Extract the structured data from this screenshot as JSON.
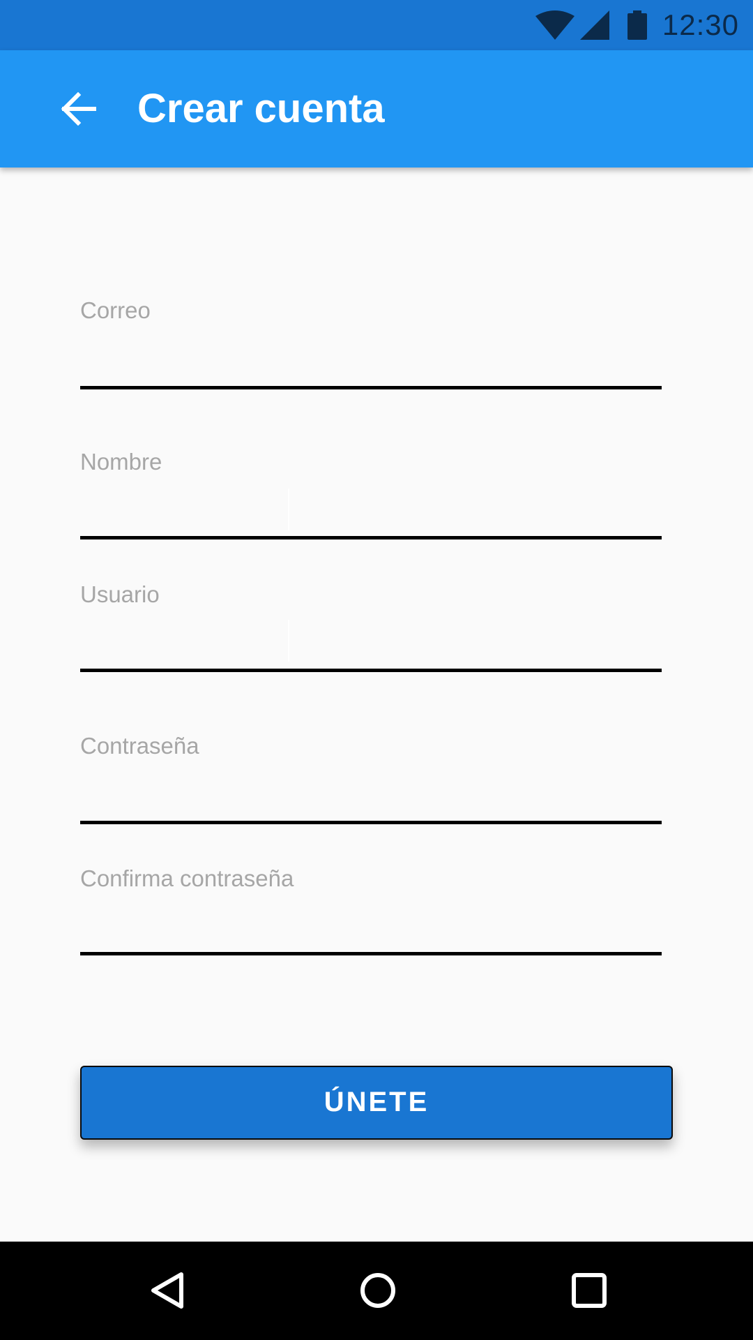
{
  "status_bar": {
    "time": "12:30",
    "icons": [
      "wifi-icon",
      "signal-icon",
      "battery-icon"
    ],
    "background": "#1976d2"
  },
  "app_bar": {
    "title": "Crear cuenta",
    "back_icon": "arrow-left-icon",
    "background": "#2196f3"
  },
  "form": {
    "fields": [
      {
        "label": "Correo",
        "value": ""
      },
      {
        "label": "Nombre",
        "value": ""
      },
      {
        "label": "Usuario",
        "value": ""
      },
      {
        "label": "Contraseña",
        "value": ""
      },
      {
        "label": "Confirma contraseña",
        "value": ""
      }
    ]
  },
  "join_button": {
    "label": "ÚNETE",
    "background": "#1976d2"
  },
  "nav_bar": {
    "icons": [
      "back-triangle-icon",
      "home-circle-icon",
      "recents-square-icon"
    ]
  }
}
